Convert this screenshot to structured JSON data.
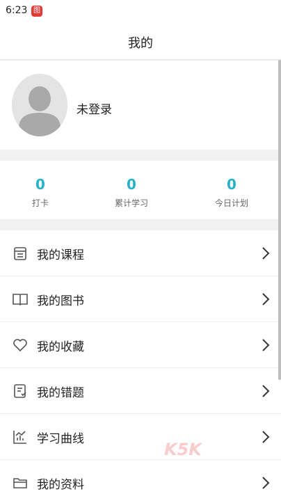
{
  "status_bar": {
    "time": "6:23",
    "app_icon_glyph": "图"
  },
  "header": {
    "title": "我的"
  },
  "profile": {
    "login_status": "未登录"
  },
  "stats": [
    {
      "value": "0",
      "label": "打卡"
    },
    {
      "value": "0",
      "label": "累计学习"
    },
    {
      "value": "0",
      "label": "今日计划"
    }
  ],
  "menu": [
    {
      "label": "我的课程",
      "icon": "course-icon"
    },
    {
      "label": "我的图书",
      "icon": "book-icon"
    },
    {
      "label": "我的收藏",
      "icon": "heart-icon"
    },
    {
      "label": "我的错题",
      "icon": "wrong-questions-icon"
    },
    {
      "label": "学习曲线",
      "icon": "chart-icon"
    },
    {
      "label": "我的资料",
      "icon": "folder-icon"
    }
  ],
  "watermark": {
    "text": "K5K"
  },
  "colors": {
    "accent": "#26b3c7",
    "background": "#f2f2f2",
    "card": "#ffffff"
  }
}
